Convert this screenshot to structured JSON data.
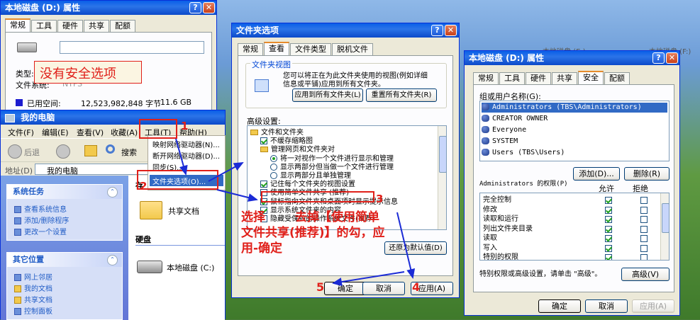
{
  "colors": {
    "titlebar": "#0a5fe8",
    "annotation_red": "#e0201a",
    "arrow_blue": "#1b2bd6",
    "tab_highlight": "#e68b2c"
  },
  "disk_props": {
    "title": "本地磁盘 (D:) 属性",
    "tabs": [
      "常规",
      "工具",
      "硬件",
      "共享",
      "配额"
    ],
    "type_label": "类型:",
    "fs_label": "文件系统:",
    "fs_value": "NTFS",
    "used_label": "已用空间:",
    "used_bytes": "12,523,982,848 字节",
    "used_gb": "11.6 GB"
  },
  "annot_no_security": "没有安全选项",
  "my_computer": {
    "title": "我的电脑",
    "menu": [
      "文件(F)",
      "编辑(E)",
      "查看(V)",
      "收藏(A)",
      "工具(T)",
      "帮助(H)"
    ],
    "back": "后退",
    "search": "搜索",
    "address_label": "地址(D)",
    "address_value": "我的电脑",
    "tools_menu": [
      "映射网络驱动器(N)...",
      "断开网络驱动器(D)...",
      "同步(S)...",
      "文件夹选项(O)..."
    ],
    "system_tasks": {
      "title": "系统任务",
      "items": [
        "查看系统信息",
        "添加/删除程序",
        "更改一个设置"
      ]
    },
    "other_places": {
      "title": "其它位置",
      "items": [
        "网上邻居",
        "我的文档",
        "共享文档",
        "控制面板"
      ]
    },
    "files_header": "存",
    "shared_docs": "共享文档",
    "disks_header": "硬盘",
    "local_disk": "本地磁盘 (C:)"
  },
  "folder_options": {
    "title": "文件夹选项",
    "tabs": [
      "常规",
      "查看",
      "文件类型",
      "脱机文件"
    ],
    "views_group": "文件夹视图",
    "views_desc": [
      "您可以将正在为此文件夹使用的视图(例如详细",
      "信息或平铺)应用到所有文件夹。"
    ],
    "apply_all": "应用到所有文件夹(L)",
    "reset_all": "重置所有文件夹(R)",
    "advanced_label": "高级设置:",
    "tree": [
      {
        "kind": "folder",
        "label": "文件和文件夹",
        "indent": 0
      },
      {
        "kind": "check",
        "label": "不缓存缩略图",
        "on": true,
        "indent": 1
      },
      {
        "kind": "folder",
        "label": "管理网页和文件夹对",
        "indent": 1
      },
      {
        "kind": "radio",
        "label": "将一对视作一个文件进行显示和管理",
        "on": true,
        "indent": 2
      },
      {
        "kind": "radio",
        "label": "显示两部分但当做一个文件进行管理",
        "on": false,
        "indent": 2
      },
      {
        "kind": "radio",
        "label": "显示两部分且单独管理",
        "on": false,
        "indent": 2
      },
      {
        "kind": "check",
        "label": "记住每个文件夹的视图设置",
        "on": true,
        "indent": 1
      },
      {
        "kind": "check",
        "label": "使用简单文件共享 (推荐)",
        "on": false,
        "indent": 1
      },
      {
        "kind": "check",
        "label": "鼠标指向文件夹和桌面项时显示提示信息",
        "on": true,
        "indent": 1
      },
      {
        "kind": "check",
        "label": "显示系统文件夹的内容",
        "on": true,
        "indent": 1
      },
      {
        "kind": "check",
        "label": "隐藏受保护的操作系统文件(推荐)",
        "on": false,
        "indent": 1
      }
    ],
    "restore": "还原为默认值(D)",
    "ok": "确定",
    "cancel": "取消",
    "apply": "应用(A)"
  },
  "annot_instruction": [
    "选择",
    "去掉【使用简单",
    "文件共享(推荐)】的勾，应",
    "用-确定"
  ],
  "step_numbers": [
    "1",
    "2",
    "3",
    "4",
    "5"
  ],
  "security": {
    "title": "本地磁盘 (D:) 属性",
    "tabs": [
      "常规",
      "工具",
      "硬件",
      "共享",
      "安全",
      "配额"
    ],
    "group_label": "组或用户名称(G):",
    "users": [
      "Administrators (TBS\\Administrators)",
      "CREATOR OWNER",
      "Everyone",
      "SYSTEM",
      "Users (TBS\\Users)"
    ],
    "add": "添加(D)...",
    "remove": "删除(R)",
    "perm_label": "Administrators 的权限(P)",
    "allow": "允许",
    "deny": "拒绝",
    "perms": [
      "完全控制",
      "修改",
      "读取和运行",
      "列出文件夹目录",
      "读取",
      "写入",
      "特别的权限"
    ],
    "special_text": "特别权限或高级设置，请单击 \"高级\"。",
    "advanced": "高级(V)",
    "ok": "确定",
    "cancel": "取消",
    "apply": "应用(A)"
  },
  "bg_windows": [
    "本地磁盘 (E:)",
    "本地磁盘 (F:)"
  ]
}
